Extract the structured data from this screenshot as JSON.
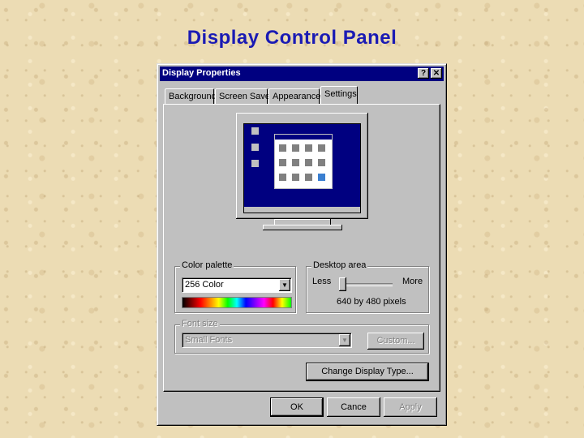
{
  "slide": {
    "title": "Display Control Panel"
  },
  "dialog": {
    "title": "Display Properties",
    "help_label": "?",
    "close_label": "✕",
    "tabs": [
      {
        "label": "Background"
      },
      {
        "label": "Screen Saver"
      },
      {
        "label": "Appearance"
      },
      {
        "label": "Settings",
        "active": true
      }
    ],
    "color_palette": {
      "legend": "Color palette",
      "selected": "256 Color"
    },
    "desktop_area": {
      "legend": "Desktop area",
      "less_label": "Less",
      "more_label": "More",
      "resolution": "640 by 480 pixels",
      "slider_level_fraction": 0.0
    },
    "font_size": {
      "legend": "Font size",
      "selected": "Small Fonts",
      "custom_label": "Custom..."
    },
    "change_display_label": "Change Display Type...",
    "buttons": {
      "ok": "OK",
      "cancel": "Cance",
      "apply": "Apply"
    }
  },
  "colors": {
    "title_text": "#1b1bb4",
    "titlebar": "#000080",
    "window_face": "#c0c0c0",
    "desktop_preview": "#000080"
  }
}
